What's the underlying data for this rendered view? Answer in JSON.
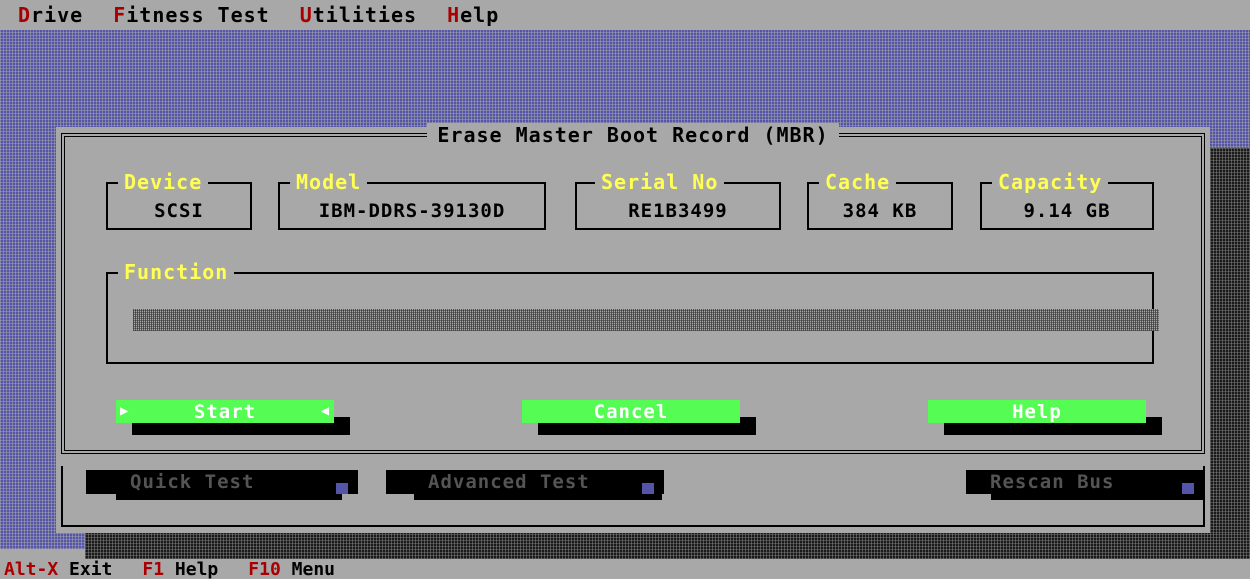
{
  "menubar": {
    "items": [
      {
        "hotkey": "D",
        "rest": "rive"
      },
      {
        "hotkey": "F",
        "rest": "itness Test"
      },
      {
        "hotkey": "U",
        "rest": "tilities"
      },
      {
        "hotkey": "H",
        "rest": "elp"
      }
    ]
  },
  "dialog": {
    "title": "Erase Master Boot Record (MBR)",
    "device": {
      "label": "Device",
      "value": "SCSI"
    },
    "model": {
      "label": "Model",
      "value": "IBM-DDRS-39130D"
    },
    "serial": {
      "label": "Serial No",
      "value": "RE1B3499"
    },
    "cache": {
      "label": "Cache",
      "value": "384 KB"
    },
    "capacity": {
      "label": "Capacity",
      "value": "9.14 GB"
    },
    "function": {
      "label": "Function",
      "progress": 0
    },
    "buttons": {
      "start": "Start",
      "cancel": "Cancel",
      "help": "Help"
    }
  },
  "background_window": {
    "buttons": {
      "quick_test": "Quick Test",
      "advanced_test": "Advanced Test",
      "rescan_bus": "Rescan Bus"
    }
  },
  "statusbar": {
    "items": [
      {
        "key": "Alt-X",
        "action": "Exit"
      },
      {
        "key": "F1",
        "action": "Help"
      },
      {
        "key": "F10",
        "action": "Menu"
      }
    ]
  },
  "colors": {
    "background": "#a8a8a8",
    "desktop_hatch": "#5454a8",
    "hotkey": "#a80000",
    "label_yellow": "#ffff54",
    "button_green": "#54fc54",
    "button_text": "#ffffff"
  }
}
